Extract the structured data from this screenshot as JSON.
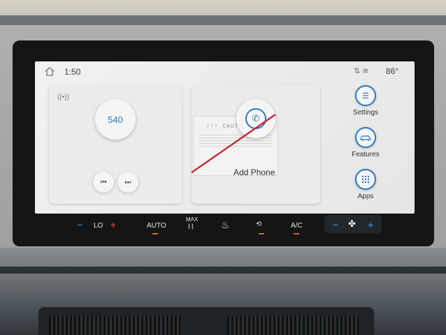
{
  "status_bar": {
    "time": "1:50",
    "status_icons": "⇅ ≋",
    "temperature": "86°"
  },
  "radio": {
    "frequency": "540",
    "seek_back_glyph": "⏮",
    "seek_forward_glyph": "⏭"
  },
  "phone": {
    "label": "Add Phone",
    "sticker_text": "!!! CAUTION !!!"
  },
  "shortcuts": [
    {
      "label": "Settings",
      "icon": "sliders-icon",
      "glyph": "☰"
    },
    {
      "label": "Features",
      "icon": "car-icon",
      "glyph": "🚗"
    },
    {
      "label": "Apps",
      "icon": "grid-icon",
      "glyph": "⁞⁞"
    }
  ],
  "climate": {
    "temp_minus": "−",
    "temp_value": "LO",
    "temp_plus": "+",
    "auto": "AUTO",
    "max": "MAX",
    "ac": "A/C",
    "fan_minus": "−",
    "fan_plus": "+"
  },
  "colors": {
    "accent": "#2b78c4",
    "indicator": "#d7602a"
  }
}
